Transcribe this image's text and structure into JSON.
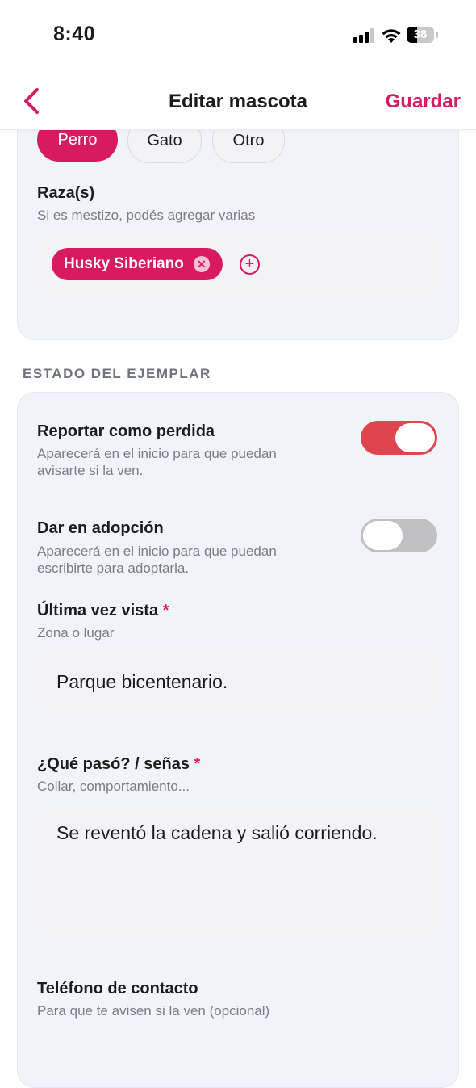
{
  "status_bar": {
    "time": "8:40",
    "battery": "38",
    "battery_level": 0.38
  },
  "nav": {
    "back_icon": "chevron-left-icon",
    "title": "Editar mascota",
    "save": "Guardar"
  },
  "species": {
    "options": [
      "Perro",
      "Gato",
      "Otro"
    ],
    "selected": "Perro"
  },
  "breeds": {
    "label": "Raza(s)",
    "hint": "Si es mestizo, podés agregar varias",
    "tags": [
      "Husky Siberiano"
    ],
    "remove_icon": "close-circle-icon",
    "add_icon": "plus-circle-icon"
  },
  "status_section": {
    "header": "ESTADO DEL EJEMPLAR",
    "lost": {
      "label": "Reportar como perdida",
      "description_line1": "Aparecerá en el inicio para que puedan",
      "description_line2": "avisarte si la ven.",
      "enabled": true
    },
    "adoption": {
      "label": "Dar en adopción",
      "description_line1": "Aparecerá en el inicio para que puedan",
      "description_line2": "escribirte para adoptarla.",
      "enabled": false
    }
  },
  "last_seen": {
    "label": "Última vez vista",
    "required_mark": "*",
    "hint": "Zona o lugar",
    "value": "Parque bicentenario."
  },
  "what_happened": {
    "label": "¿Qué pasó? / señas",
    "required_mark": "*",
    "hint": "Collar, comportamiento...",
    "value": "Se reventó la cadena y salió corriendo."
  },
  "contact_phone": {
    "label": "Teléfono de contacto",
    "hint": "Para que te avisen si la ven (opcional)"
  },
  "colors": {
    "accent": "#d81b60",
    "toggle_on": "#e0454f",
    "card_bg": "#f0f3fa"
  }
}
